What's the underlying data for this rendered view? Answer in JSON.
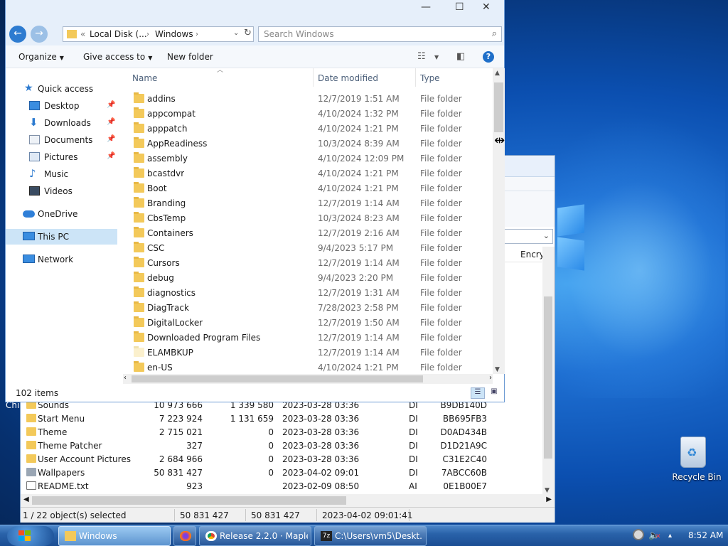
{
  "explorer": {
    "breadcrumb_prefix": "«",
    "breadcrumb": [
      "Local Disk (...",
      "Windows"
    ],
    "search_placeholder": "Search Windows",
    "toolbar": {
      "organize": "Organize",
      "give_access": "Give access to",
      "new_folder": "New folder",
      "help": "?"
    },
    "nav": {
      "quick_access": "Quick access",
      "items": [
        {
          "label": "Desktop",
          "icon": "desktop-icon",
          "pinned": true
        },
        {
          "label": "Downloads",
          "icon": "downloads-icon",
          "pinned": true
        },
        {
          "label": "Documents",
          "icon": "documents-icon",
          "pinned": true
        },
        {
          "label": "Pictures",
          "icon": "pictures-icon",
          "pinned": true
        },
        {
          "label": "Music",
          "icon": "music-icon",
          "pinned": false
        },
        {
          "label": "Videos",
          "icon": "videos-icon",
          "pinned": false
        }
      ],
      "onedrive": "OneDrive",
      "this_pc": "This PC",
      "network": "Network"
    },
    "columns": {
      "name": "Name",
      "date": "Date modified",
      "type": "Type"
    },
    "files": [
      {
        "name": "addins",
        "date": "12/7/2019 1:51 AM",
        "type": "File folder"
      },
      {
        "name": "appcompat",
        "date": "4/10/2024 1:32 PM",
        "type": "File folder"
      },
      {
        "name": "apppatch",
        "date": "4/10/2024 1:21 PM",
        "type": "File folder"
      },
      {
        "name": "AppReadiness",
        "date": "10/3/2024 8:39 AM",
        "type": "File folder"
      },
      {
        "name": "assembly",
        "date": "4/10/2024 12:09 PM",
        "type": "File folder"
      },
      {
        "name": "bcastdvr",
        "date": "4/10/2024 1:21 PM",
        "type": "File folder"
      },
      {
        "name": "Boot",
        "date": "4/10/2024 1:21 PM",
        "type": "File folder"
      },
      {
        "name": "Branding",
        "date": "12/7/2019 1:14 AM",
        "type": "File folder"
      },
      {
        "name": "CbsTemp",
        "date": "10/3/2024 8:23 AM",
        "type": "File folder"
      },
      {
        "name": "Containers",
        "date": "12/7/2019 2:16 AM",
        "type": "File folder"
      },
      {
        "name": "CSC",
        "date": "9/4/2023 5:17 PM",
        "type": "File folder"
      },
      {
        "name": "Cursors",
        "date": "12/7/2019 1:14 AM",
        "type": "File folder"
      },
      {
        "name": "debug",
        "date": "9/4/2023 2:20 PM",
        "type": "File folder"
      },
      {
        "name": "diagnostics",
        "date": "12/7/2019 1:31 AM",
        "type": "File folder"
      },
      {
        "name": "DiagTrack",
        "date": "7/28/2023 2:58 PM",
        "type": "File folder"
      },
      {
        "name": "DigitalLocker",
        "date": "12/7/2019 1:50 AM",
        "type": "File folder"
      },
      {
        "name": "Downloaded Program Files",
        "date": "12/7/2019 1:14 AM",
        "type": "File folder"
      },
      {
        "name": "ELAMBKUP",
        "date": "12/7/2019 1:14 AM",
        "type": "File folder"
      },
      {
        "name": "en-US",
        "date": "4/10/2024 1:21 PM",
        "type": "File folder"
      }
    ],
    "status": "102 items"
  },
  "zip": {
    "col_encry": "Encry",
    "rows": [
      {
        "name": "Sounds",
        "size": "10 973 666",
        "packed": "1 339 580",
        "modified": "2023-03-28 03:36",
        "attr": "DI",
        "crc": "B9DB140D",
        "icon": "folder"
      },
      {
        "name": "Start Menu",
        "size": "7 223 924",
        "packed": "1 131 659",
        "modified": "2023-03-28 03:36",
        "attr": "DI",
        "crc": "BB695FB3",
        "icon": "folder"
      },
      {
        "name": "Theme",
        "size": "2 715 021",
        "packed": "0",
        "modified": "2023-03-28 03:36",
        "attr": "DI",
        "crc": "D0AD434B",
        "icon": "folder"
      },
      {
        "name": "Theme Patcher",
        "size": "327",
        "packed": "0",
        "modified": "2023-03-28 03:36",
        "attr": "DI",
        "crc": "D1D21A9C",
        "icon": "folder"
      },
      {
        "name": "User Account Pictures",
        "size": "2 684 966",
        "packed": "0",
        "modified": "2023-03-28 03:36",
        "attr": "DI",
        "crc": "C31E2C40",
        "icon": "folder"
      },
      {
        "name": "Wallpapers",
        "size": "50 831 427",
        "packed": "0",
        "modified": "2023-04-02 09:01",
        "attr": "DI",
        "crc": "7ABCC60B",
        "icon": "image"
      },
      {
        "name": "README.txt",
        "size": "923",
        "packed": "",
        "modified": "2023-02-09 08:50",
        "attr": "AI",
        "crc": "0E1B00E7",
        "icon": "document"
      }
    ],
    "status": {
      "selected": "1 / 22 object(s) selected",
      "size": "50 831 427",
      "packed": "50 831 427",
      "modified": "2023-04-02 09:01:41"
    }
  },
  "desktop": {
    "side_label": "Chi",
    "recycle_bin": "Recycle Bin"
  },
  "taskbar": {
    "buttons": [
      {
        "label": "Windows",
        "icon": "folder-icon",
        "active": true
      },
      {
        "label": "",
        "icon": "firefox-icon",
        "active": false
      },
      {
        "label": "Release 2.2.0 · Maple...",
        "icon": "chrome-icon",
        "active": false
      },
      {
        "label": "C:\\Users\\vm5\\Deskt...",
        "icon": "7zip-icon",
        "active": false
      }
    ],
    "time": "8:52 AM"
  },
  "colors": {
    "folder": "#f3c95a",
    "selection": "#cce4f7",
    "taskbar": "#2a63aa"
  }
}
